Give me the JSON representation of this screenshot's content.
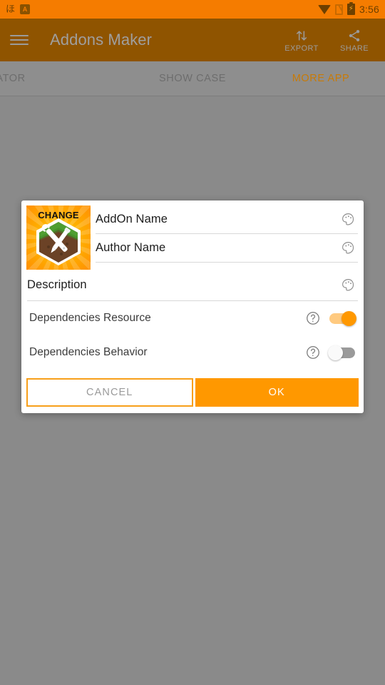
{
  "status_bar": {
    "icons": [
      "bug-icon",
      "app-badge-icon",
      "wifi-icon",
      "sim-card-icon",
      "battery-charging-icon"
    ],
    "badge_letter": "A",
    "battery_glyph": "⚡",
    "time": "3:56",
    "background_color": "#f57c00"
  },
  "app_bar": {
    "menu_icon": "hamburger-menu-icon",
    "title": "Addons Maker",
    "background_color": "#8f5400",
    "actions": [
      {
        "label": "EXPORT",
        "icon": "export-arrows-icon"
      },
      {
        "label": "SHARE",
        "icon": "share-nodes-icon"
      }
    ]
  },
  "tabs": {
    "items": [
      {
        "label": "CREATOR",
        "active": false,
        "partial": true
      },
      {
        "label": "SHOW CASE",
        "active": false,
        "partial": false
      },
      {
        "label": "MORE APP",
        "active": true,
        "partial": false
      }
    ],
    "active_color": "#c87a06",
    "inactive_color": "#6d6d6d",
    "background_color": "#8e8e8e"
  },
  "dialog": {
    "icon": {
      "change_label": "CHANGE",
      "icon_name": "addon-block-wrench-icon"
    },
    "fields": [
      {
        "text": "AddOn Name",
        "action_icon": "palette-icon"
      },
      {
        "text": "Author Name",
        "action_icon": "palette-icon"
      },
      {
        "text": "Description",
        "action_icon": "palette-icon"
      }
    ],
    "dependencies": [
      {
        "label": "Dependencies Resource",
        "help_icon": "help-circle-icon",
        "toggle_state": "on"
      },
      {
        "label": "Dependencies Behavior",
        "help_icon": "help-circle-icon",
        "toggle_state": "off"
      }
    ],
    "buttons": {
      "cancel_label": "CANCEL",
      "ok_label": "OK"
    },
    "accent_color": "#ff9800",
    "background_color": "#ffffff"
  },
  "scrim": {
    "color": "#8a8a8a"
  }
}
